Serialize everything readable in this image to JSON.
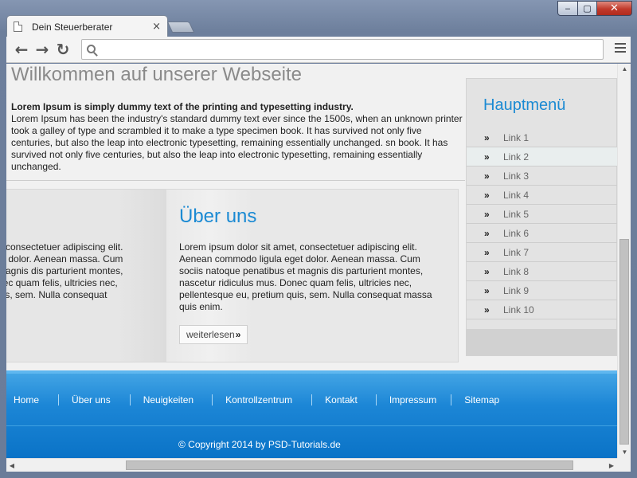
{
  "window": {
    "minimize": "‒",
    "maximize": "▢",
    "close": "✕"
  },
  "tab": {
    "title": "Dein Steuerberater",
    "close": "×"
  },
  "toolbar": {
    "back": "←",
    "forward": "→",
    "reload": "↻",
    "address_value": ""
  },
  "page": {
    "welcome_title": "Willkommen auf unserer Webseite",
    "intro_bold": "Lorem Ipsum is simply dummy text of the printing and typesetting industry.",
    "intro_text": "Lorem Ipsum has been the industry's standard dummy text ever since the 1500s, when an unknown printer took a galley of type and scrambled it to make a type specimen book. It has survived not only five centuries, but also the leap into electronic typesetting, remaining essentially unchanged. sn book. It has survived not only five centuries, but also the leap into electronic typesetting, remaining essentially unchanged.",
    "left_box_text": "t, consectetuer adipiscing elit.\net dolor. Aenean massa. Cum\nmagnis dis parturient montes,\nnec quam felis, ultricies nec,\nuis, sem. Nulla consequat",
    "about": {
      "title": "Über uns",
      "text": "Lorem ipsum dolor sit amet, consectetuer adipiscing elit. Aenean commodo ligula eget dolor. Aenean massa. Cum sociis natoque penatibus et magnis dis parturient montes, nascetur ridiculus mus. Donec quam felis, ultricies nec, pellentesque eu, pretium quis, sem. Nulla consequat massa quis enim.",
      "more_label": "weiterlesen",
      "more_arrow": "»"
    }
  },
  "sidebar": {
    "title": "Hauptmenü",
    "bullet": "»",
    "items": [
      {
        "label": "Link 1"
      },
      {
        "label": "Link 2"
      },
      {
        "label": "Link 3"
      },
      {
        "label": "Link 4"
      },
      {
        "label": "Link 5"
      },
      {
        "label": "Link 6"
      },
      {
        "label": "Link 7"
      },
      {
        "label": "Link 8"
      },
      {
        "label": "Link 9"
      },
      {
        "label": "Link 10"
      }
    ]
  },
  "footer": {
    "nav": [
      "Home",
      "Über uns",
      "Neuigkeiten",
      "Kontrollzentrum",
      "Kontakt",
      "Impressum",
      "Sitemap"
    ],
    "copyright": "© Copyright 2014 by PSD-Tutorials.de"
  },
  "colors": {
    "accent": "#1b8ad3",
    "footer_blue": "#0a73c7"
  }
}
